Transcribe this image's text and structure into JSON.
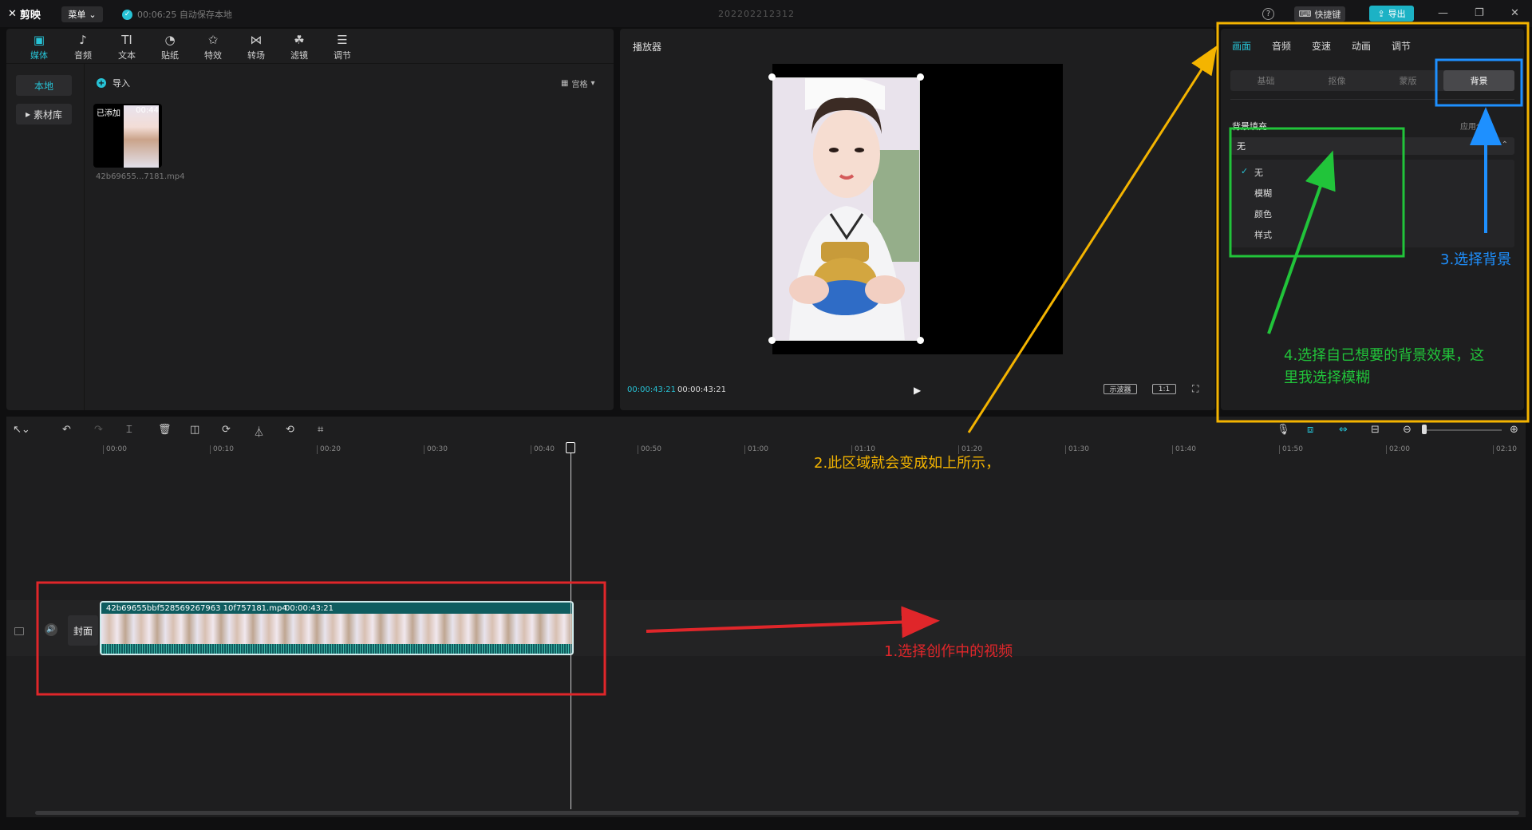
{
  "titlebar": {
    "logo": "剪映",
    "menu_label": "菜单",
    "autosave": "00:06:25 自动保存本地",
    "project_name": "202202212312",
    "shortcut_label": "快捷键",
    "export_label": "导出"
  },
  "media_toolbar": [
    {
      "label": "媒体",
      "icon": "media-icon"
    },
    {
      "label": "音频",
      "icon": "audio-icon"
    },
    {
      "label": "文本",
      "icon": "text-icon"
    },
    {
      "label": "贴纸",
      "icon": "sticker-icon"
    },
    {
      "label": "特效",
      "icon": "effects-icon"
    },
    {
      "label": "转场",
      "icon": "transition-icon"
    },
    {
      "label": "滤镜",
      "icon": "filter-icon"
    },
    {
      "label": "调节",
      "icon": "adjust-icon"
    }
  ],
  "media_side": {
    "local": "本地",
    "library": "素材库"
  },
  "media_main": {
    "import_label": "导入",
    "grid_label": "宫格",
    "thumb_added": "已添加",
    "thumb_duration": "00:44",
    "thumb_filename": "42b69655...7181.mp4"
  },
  "player": {
    "title": "播放器",
    "current_time": "00:00:43:21",
    "total_time": "00:00:43:21",
    "scope_label": "示波器",
    "ratio_label": "1:1"
  },
  "inspector": {
    "tabs": [
      "画面",
      "音频",
      "变速",
      "动画",
      "调节"
    ],
    "subtabs": [
      "基础",
      "抠像",
      "蒙版",
      "背景"
    ],
    "bg_fill_label": "背景填充",
    "apply_all": "应用全部",
    "dropdown_value": "无",
    "options": [
      "无",
      "模糊",
      "颜色",
      "样式"
    ]
  },
  "timeline": {
    "ruler": [
      "00:00",
      "00:10",
      "00:20",
      "00:30",
      "00:40",
      "00:50",
      "01:00",
      "01:10",
      "01:20",
      "01:30",
      "01:40",
      "01:50",
      "02:00",
      "02:10"
    ],
    "cover_label": "封面",
    "clip_name": "42b69655bbf528569267963 10f757181.mp4",
    "clip_duration": "00:00:43:21"
  },
  "annotations": {
    "step1": "1.选择创作中的视频",
    "step2": "2.此区域就会变成如上所示，",
    "step3": "3.选择背景",
    "step4_line1": "4.选择自己想要的背景效果，这",
    "step4_line2": "里我选择模糊",
    "colors": {
      "red": "#e0262a",
      "orange": "#f4b400",
      "blue": "#1e90ff",
      "green": "#21c43a"
    }
  }
}
